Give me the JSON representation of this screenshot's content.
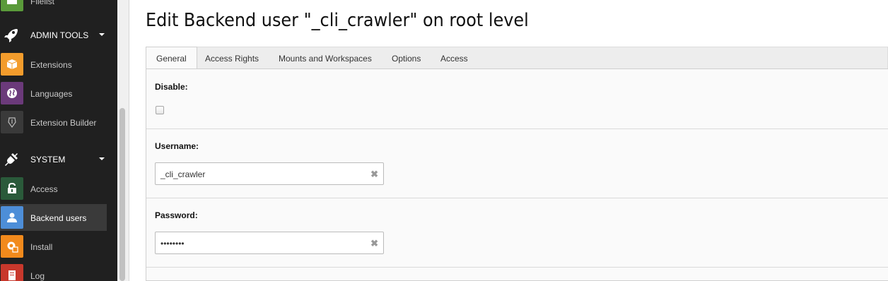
{
  "sidebar": {
    "top_partial_label": "Filelist",
    "groups": [
      {
        "label": "ADMIN TOOLS"
      },
      {
        "label": "SYSTEM"
      }
    ],
    "items": [
      {
        "label": "Extensions",
        "color": "#f39c2c"
      },
      {
        "label": "Languages",
        "color": "#6b3a7a"
      },
      {
        "label": "Extension Builder",
        "color": "#3a3a3a"
      },
      {
        "label": "Access",
        "color": "#2a5a3a"
      },
      {
        "label": "Backend users",
        "color": "#4d8ed8"
      },
      {
        "label": "Install",
        "color": "#f28a1c"
      },
      {
        "label": "Log",
        "color": "#c8382c"
      }
    ]
  },
  "page": {
    "title": "Edit Backend user \"_cli_crawler\" on root level"
  },
  "tabs": [
    {
      "label": "General",
      "active": true
    },
    {
      "label": "Access Rights"
    },
    {
      "label": "Mounts and Workspaces"
    },
    {
      "label": "Options"
    },
    {
      "label": "Access"
    }
  ],
  "form": {
    "disable_label": "Disable:",
    "username_label": "Username:",
    "username_value": "_cli_crawler",
    "password_label": "Password:",
    "password_value": "••••••••"
  }
}
